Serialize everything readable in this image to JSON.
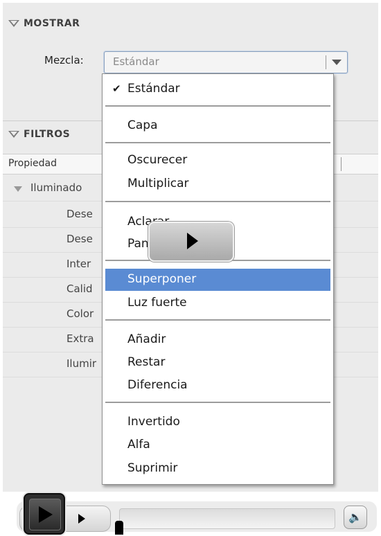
{
  "panel": {
    "mostrar_header": "MOSTRAR",
    "mezcla_label": "Mezcla:",
    "mezcla_value": "Estándar",
    "filtros_header": "FILTROS",
    "column_header": "Propiedad",
    "rows": [
      "Iluminado",
      "Dese",
      "Dese",
      "Inter",
      "Calid",
      "Color",
      "Extra",
      "Ilumir"
    ]
  },
  "menu": {
    "check_glyph": "✔",
    "groups": [
      [
        "Estándar"
      ],
      [
        "Capa"
      ],
      [
        "Oscurecer",
        "Multiplicar"
      ],
      [
        "Aclarar",
        "Pantalla"
      ],
      [
        "Superponer",
        "Luz fuerte"
      ],
      [
        "Añadir",
        "Restar",
        "Diferencia"
      ],
      [
        "Invertido",
        "Alfa",
        "Suprimir"
      ]
    ],
    "selected": "Superponer",
    "checked": "Estándar"
  },
  "colors": {
    "highlight": "#5a8bd3",
    "panel_bg": "#ebebeb"
  },
  "icons": {
    "play": "play-icon",
    "volume": "speaker-icon"
  }
}
